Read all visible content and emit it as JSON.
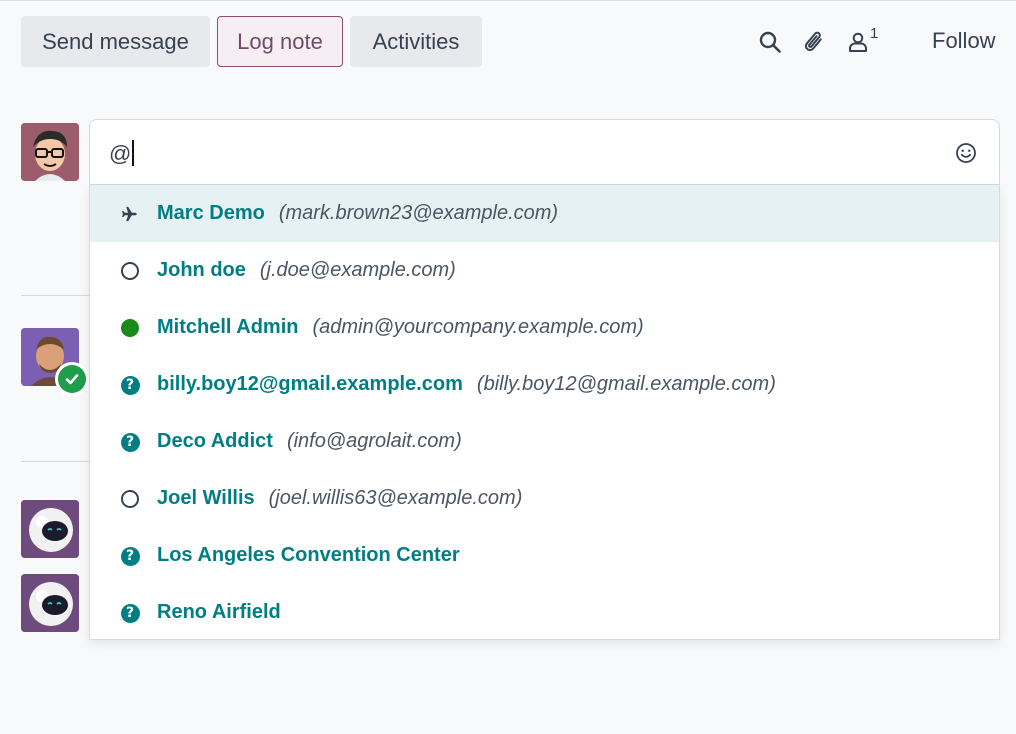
{
  "toolbar": {
    "send_message": "Send message",
    "log_note": "Log note",
    "activities": "Activities",
    "follower_count": "1",
    "follow": "Follow"
  },
  "composer": {
    "value": "@"
  },
  "suggestions": [
    {
      "name": "Marc Demo",
      "email": "(mark.brown23@example.com)",
      "icon": "plane-icon",
      "highlighted": true
    },
    {
      "name": "John doe",
      "email": "(j.doe@example.com)",
      "icon": "offline-circle-icon"
    },
    {
      "name": "Mitchell Admin",
      "email": "(admin@yourcompany.example.com)",
      "icon": "online-dot-icon"
    },
    {
      "name": "billy.boy12@gmail.example.com",
      "email": "(billy.boy12@gmail.example.com)",
      "icon": "question-icon"
    },
    {
      "name": "Deco Addict",
      "email": "(info@agrolait.com)",
      "icon": "question-icon"
    },
    {
      "name": "Joel Willis",
      "email": "(joel.willis63@example.com)",
      "icon": "offline-circle-icon"
    },
    {
      "name": "Los Angeles Convention Center",
      "email": "",
      "icon": "question-icon"
    },
    {
      "name": "Reno Airfield",
      "email": "",
      "icon": "question-icon"
    }
  ],
  "colors": {
    "accent": "#017e84",
    "log_note_active": "#714B67",
    "online": "#1a8a1a",
    "highlight_bg": "#e6f1f3"
  }
}
